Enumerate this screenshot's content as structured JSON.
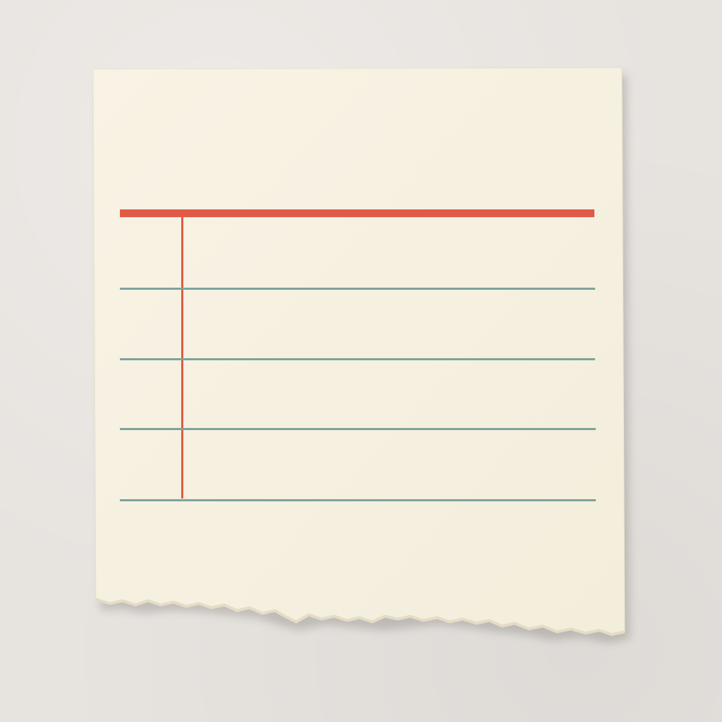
{
  "scene": {
    "description_free": true
  },
  "colors": {
    "background": "#e7e3df",
    "paper": "#f6f1e2",
    "paper_edge": "#efe8d4",
    "header_rule": "#e05a47",
    "margin_rule": "#e05a47",
    "ruled_lines": "#7fa39a"
  },
  "card": {
    "ruled_line_count": 4,
    "has_header_rule": true,
    "has_margin_rule": true,
    "bottom_edge": "torn"
  }
}
